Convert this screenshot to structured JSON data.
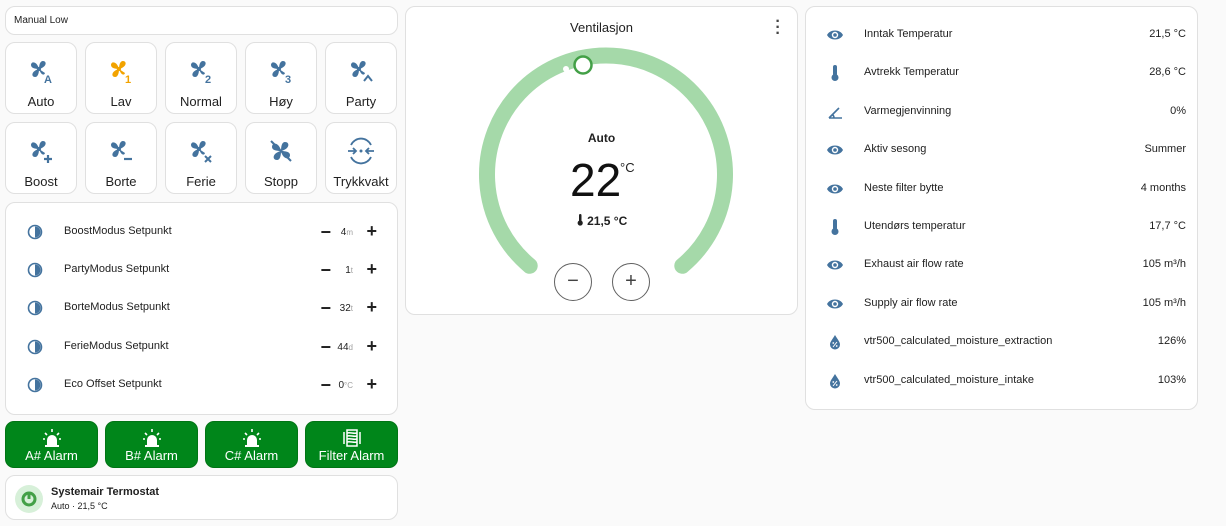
{
  "mode_card": {
    "label": "Manual Low"
  },
  "fan_buttons": [
    {
      "label": "Auto",
      "icon": "fan-auto-icon",
      "color": "#44739e"
    },
    {
      "label": "Lav",
      "icon": "fan-speed-1-icon",
      "color": "#f2a300"
    },
    {
      "label": "Normal",
      "icon": "fan-speed-2-icon",
      "color": "#44739e"
    },
    {
      "label": "Høy",
      "icon": "fan-speed-3-icon",
      "color": "#44739e"
    },
    {
      "label": "Party",
      "icon": "fan-chevron-up-icon",
      "color": "#44739e"
    },
    {
      "label": "Boost",
      "icon": "fan-plus-icon",
      "color": "#44739e"
    },
    {
      "label": "Borte",
      "icon": "fan-minus-icon",
      "color": "#44739e"
    },
    {
      "label": "Ferie",
      "icon": "fan-remove-icon",
      "color": "#44739e"
    },
    {
      "label": "Stopp",
      "icon": "fan-off-icon",
      "color": "#44739e"
    },
    {
      "label": "Trykkvakt",
      "icon": "pressure-icon",
      "color": "#44739e"
    }
  ],
  "setpoints": [
    {
      "name": "BoostModus Setpunkt",
      "value": "4",
      "unit": "m"
    },
    {
      "name": "PartyModus Setpunkt",
      "value": "1",
      "unit": "t"
    },
    {
      "name": "BorteModus Setpunkt",
      "value": "32",
      "unit": "t"
    },
    {
      "name": "FerieModus Setpunkt",
      "value": "44",
      "unit": "d"
    },
    {
      "name": "Eco Offset Setpunkt",
      "value": "0",
      "unit": "°C"
    }
  ],
  "alarms": [
    {
      "label": "A# Alarm",
      "icon": "alarm-light-icon"
    },
    {
      "label": "B# Alarm",
      "icon": "alarm-light-icon"
    },
    {
      "label": "C# Alarm",
      "icon": "alarm-light-icon"
    },
    {
      "label": "Filter Alarm",
      "icon": "air-filter-icon"
    }
  ],
  "thermostat_tile": {
    "name": "Systemair Termostat",
    "state": "Auto · 21,5 °C"
  },
  "climate": {
    "title": "Ventilasjon",
    "mode": "Auto",
    "target": "22",
    "unit": "°C",
    "current": "21,5 °C",
    "dial_color": "#a5d9a9",
    "handle_color": "#43a047",
    "minus_label": "−",
    "plus_label": "+"
  },
  "sensors": [
    {
      "name": "Inntak Temperatur",
      "value": "21,5 °C",
      "icon": "eye-icon"
    },
    {
      "name": "Avtrekk Temperatur",
      "value": "28,6 °C",
      "icon": "thermometer-icon"
    },
    {
      "name": "Varmegjenvinning",
      "value": "0%",
      "icon": "angle-icon"
    },
    {
      "name": "Aktiv sesong",
      "value": "Summer",
      "icon": "eye-icon"
    },
    {
      "name": "Neste filter bytte",
      "value": "4 months",
      "icon": "eye-icon"
    },
    {
      "name": "Utendørs temperatur",
      "value": "17,7 °C",
      "icon": "thermometer-icon"
    },
    {
      "name": "Exhaust air flow rate",
      "value": "105 m³/h",
      "icon": "eye-icon"
    },
    {
      "name": "Supply air flow rate",
      "value": "105 m³/h",
      "icon": "eye-icon"
    },
    {
      "name": "vtr500_calculated_moisture_extraction",
      "value": "126%",
      "icon": "water-percent-icon"
    },
    {
      "name": "vtr500_calculated_moisture_intake",
      "value": "103%",
      "icon": "water-percent-icon"
    }
  ],
  "colors": {
    "icon_blue": "#44739e",
    "alarm_green": "#00861a",
    "accent_orange": "#f2a300"
  }
}
